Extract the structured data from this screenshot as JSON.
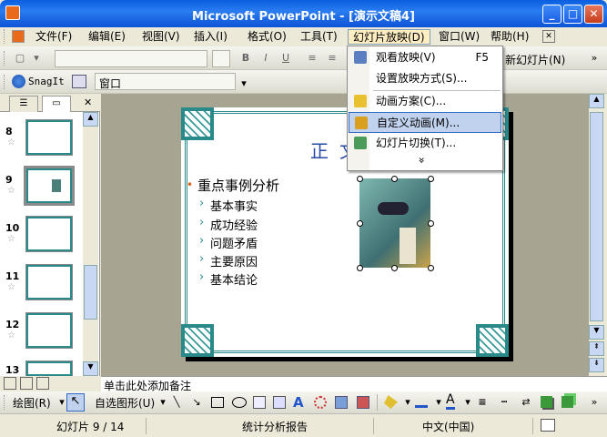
{
  "window": {
    "title": "Microsoft PowerPoint - [演示文稿4]"
  },
  "menu": {
    "items": [
      "文件(F)",
      "编辑(E)",
      "视图(V)",
      "插入(I)",
      "格式(O)",
      "工具(T)",
      "幻灯片放映(D)",
      "窗口(W)",
      "帮助(H)"
    ],
    "active": "幻灯片放映(D)"
  },
  "toolbar": {
    "new_slide": "新幻灯片(N)",
    "snagit": "SnagIt",
    "window_combo": "窗口"
  },
  "dropdown": {
    "items": [
      {
        "label": "观看放映(V)",
        "shortcut": "F5"
      },
      {
        "label": "设置放映方式(S)...",
        "shortcut": ""
      },
      {
        "label": "动画方案(C)...",
        "shortcut": ""
      },
      {
        "label": "自定义动画(M)...",
        "shortcut": ""
      },
      {
        "label": "幻灯片切换(T)...",
        "shortcut": ""
      }
    ],
    "expand": "»"
  },
  "thumbnails": {
    "numbers": [
      "8",
      "9",
      "10",
      "11",
      "12",
      "13"
    ],
    "selected": "9"
  },
  "slide": {
    "title_char1": "正",
    "title_char2": "文",
    "main_bullet": "重点事例分析",
    "sub_bullets": [
      "基本事实",
      "成功经验",
      "问题矛盾",
      "主要原因",
      "基本结论"
    ]
  },
  "notes": {
    "placeholder": "单击此处添加备注"
  },
  "drawing": {
    "draw": "绘图(R)",
    "autoshapes": "自选图形(U)"
  },
  "status": {
    "slide": "幻灯片 9 / 14",
    "design": "统计分析报告",
    "language": "中文(中国)"
  },
  "colors": {
    "accent": "#2a8a8a",
    "title_bar": "#0a5fe0",
    "highlight": "#c1d2ee"
  }
}
